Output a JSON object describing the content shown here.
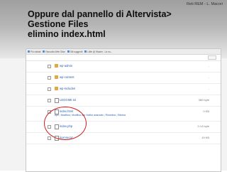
{
  "header": {
    "credit": "Reti REM - L. Macori"
  },
  "slide": {
    "title_lines": [
      "Oppure dal pannello di Altervista>",
      "Gestione Files",
      "elimino index.html"
    ]
  },
  "browser": {
    "bookmarks": [
      {
        "label": "Più visitati",
        "icon": "star-icon"
      },
      {
        "label": "Raccolta Web Slice",
        "icon": "web-slice-icon"
      },
      {
        "label": "Siti suggeriti",
        "icon": "suggested-icon"
      },
      {
        "label": "Little @ Wazier - La no...",
        "icon": "page-icon"
      }
    ]
  },
  "files": [
    {
      "name": "wp-admin",
      "size": "-",
      "type": "folder"
    },
    {
      "name": "wp-content",
      "size": "-",
      "type": "folder"
    },
    {
      "name": "wp-includes",
      "size": "-",
      "type": "folder"
    },
    {
      "name": "LEGGIMI.txt",
      "size": "380 byte",
      "type": "file"
    },
    {
      "name": "index.html",
      "size": "0 KB",
      "type": "file",
      "actions": [
        "Apri",
        "Modifica",
        "Modifica con l'editor avanzato",
        "Rinomina",
        "Elimina"
      ]
    },
    {
      "name": "index.php",
      "size": "0.14 byte",
      "type": "file"
    },
    {
      "name": "license.txt",
      "size": "19 KB",
      "type": "file"
    }
  ],
  "colors": {
    "link": "#2a62b4",
    "highlight": "#cc1e1e",
    "folder": "#e8a540"
  }
}
